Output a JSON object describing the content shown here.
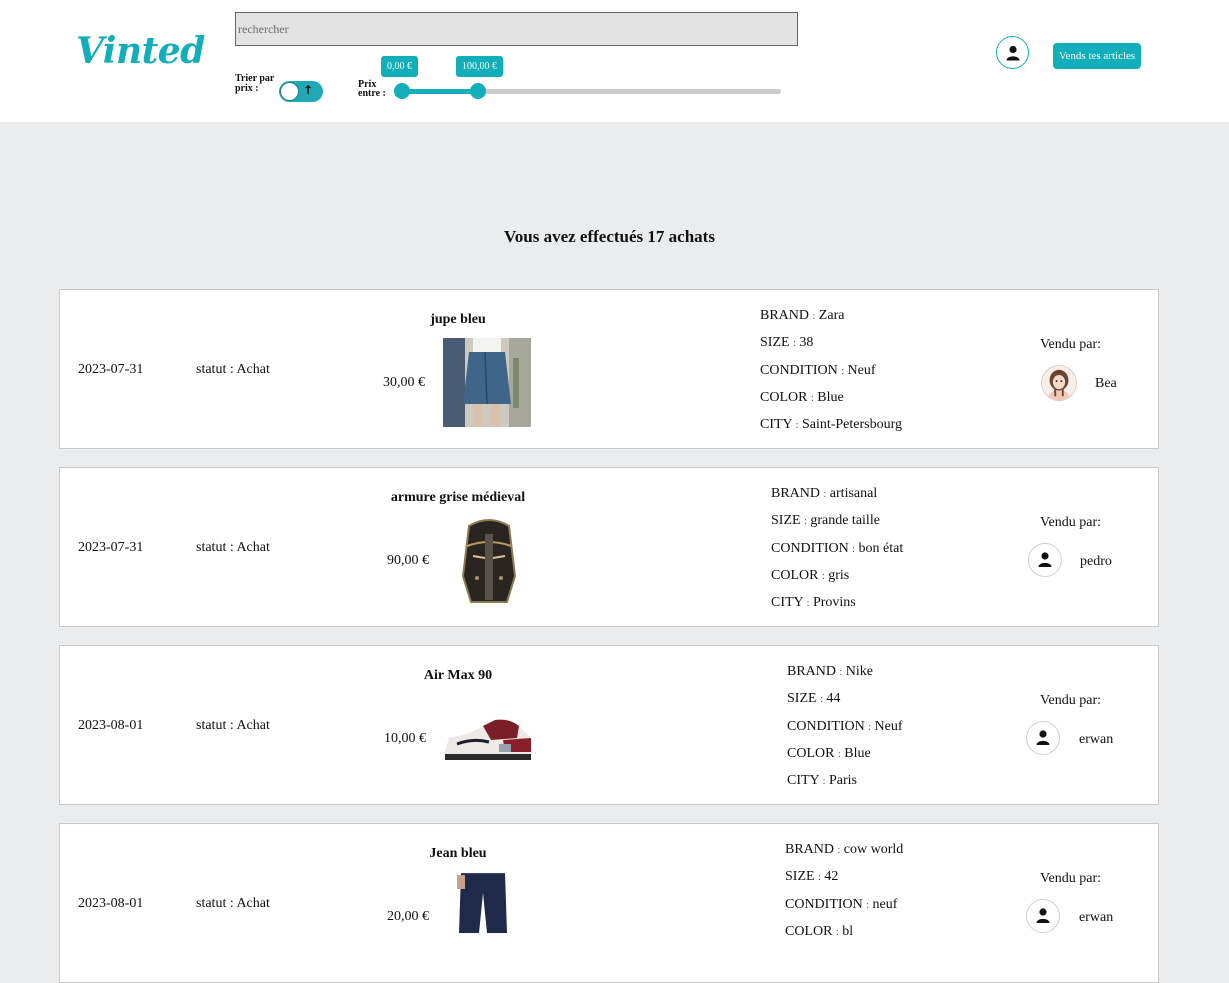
{
  "app": {
    "logo_text": "Vinted",
    "search": {
      "placeholder": "rechercher",
      "value": ""
    },
    "sort": {
      "label": "Trier par prix :",
      "ascending": true
    },
    "price_filter": {
      "label": "Prix entre :",
      "min_label": "0,00 €",
      "max_label": "100,00 €",
      "min_value": 0,
      "max_value": 100,
      "range_max": 500
    },
    "sell_button": "Vends tes articles"
  },
  "colors": {
    "accent": "#12aeb9",
    "page_bg": "#ebeced"
  },
  "main": {
    "title": "Vous avez effectués 17 achats",
    "attr_labels": {
      "brand": "BRAND",
      "size": "SIZE",
      "condition": "CONDITION",
      "color": "COLOR",
      "city": "CITY"
    },
    "sep": ":",
    "sold_by_label": "Vendu par:",
    "purchases": [
      {
        "date": "2023-07-31",
        "status": "statut : Achat",
        "name": "jupe bleu",
        "price": "30,00 €",
        "brand": "Zara",
        "size": "38",
        "condition": "Neuf",
        "color": "Blue",
        "city": "Saint-Petersbourg",
        "seller": "Bea",
        "seller_avatar": "photo",
        "image": "denim-skirt"
      },
      {
        "date": "2023-07-31",
        "status": "statut : Achat",
        "name": "armure grise médieval",
        "price": "90,00 €",
        "brand": "artisanal",
        "size": "grande taille",
        "condition": "bon état",
        "color": "gris",
        "city": "Provins",
        "seller": "pedro",
        "seller_avatar": "default",
        "image": "knight-helmet"
      },
      {
        "date": "2023-08-01",
        "status": "statut : Achat",
        "name": "Air Max 90",
        "price": "10,00 €",
        "brand": "Nike",
        "size": "44",
        "condition": "Neuf",
        "color": "Blue",
        "city": "Paris",
        "seller": "erwan",
        "seller_avatar": "default",
        "image": "sneaker"
      },
      {
        "date": "2023-08-01",
        "status": "statut : Achat",
        "name": "Jean bleu",
        "price": "20,00 €",
        "brand": "cow world",
        "size": "42",
        "condition": "neuf",
        "color": "bl",
        "seller": "erwan",
        "seller_avatar": "default",
        "image": "jeans"
      }
    ]
  }
}
